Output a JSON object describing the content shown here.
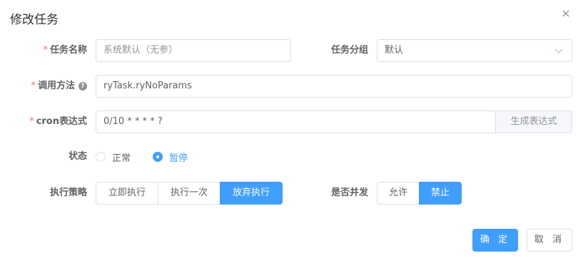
{
  "dialog": {
    "title": "修改任务"
  },
  "fields": {
    "job_name": {
      "label": "任务名称",
      "required_mark": "*",
      "value": "系统默认（无参）"
    },
    "job_group": {
      "label": "任务分组",
      "value": "默认"
    },
    "invoke_target": {
      "label": "调用方法",
      "required_mark": "*",
      "value": "ryTask.ryNoParams",
      "help_icon": "?"
    },
    "cron": {
      "label": "cron表达式",
      "required_mark": "*",
      "value": "0/10 * * * * ?",
      "append_button": "生成表达式"
    },
    "status": {
      "label": "状态",
      "options": [
        "正常",
        "暂停"
      ],
      "selected": "暂停"
    },
    "misfire": {
      "label": "执行策略",
      "options": [
        "立即执行",
        "执行一次",
        "放弃执行"
      ],
      "selected": "放弃执行"
    },
    "concurrent": {
      "label": "是否并发",
      "options": [
        "允许",
        "禁止"
      ],
      "selected": "禁止"
    }
  },
  "footer": {
    "confirm": "确 定",
    "cancel": "取 消"
  },
  "colors": {
    "primary": "#409eff",
    "required": "#f56c6c",
    "border": "#dcdfe6",
    "text": "#606266"
  }
}
